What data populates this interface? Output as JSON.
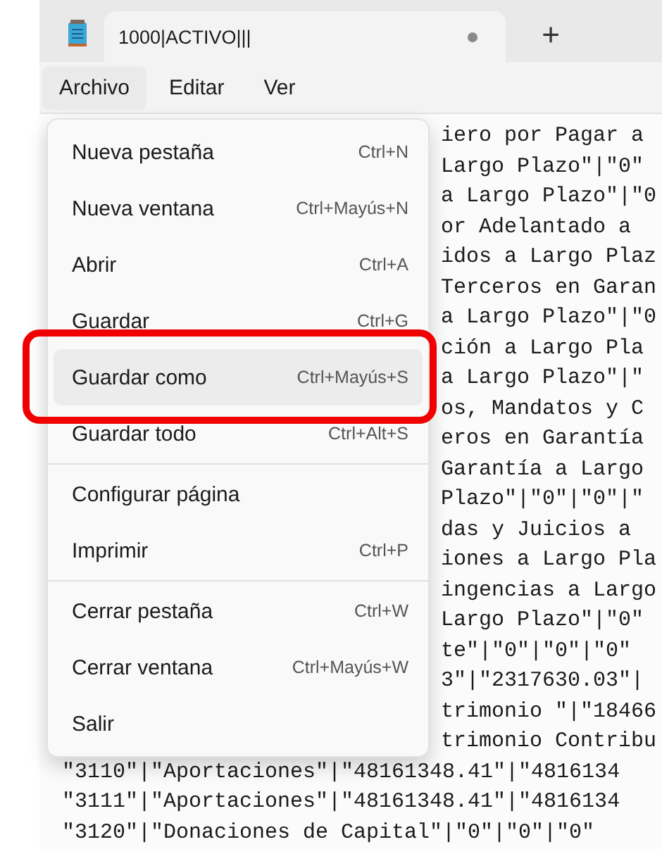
{
  "tabs": [
    {
      "title": "1000|ACTIVO|||",
      "selected": true,
      "unsaved": true
    }
  ],
  "new_tab_button": "+",
  "menu_bar": [
    {
      "label": "Archivo",
      "selected": true
    },
    {
      "label": "Editar",
      "selected": false
    },
    {
      "label": "Ver",
      "selected": false
    }
  ],
  "editor_lines": [
    {
      "kind": "partial",
      "text": "iero por Pagar a"
    },
    {
      "kind": "partial",
      "text": "Largo Plazo\"|\"0\""
    },
    {
      "kind": "partial",
      "text": "a Largo Plazo\"|\"0"
    },
    {
      "kind": "partial",
      "text": "or Adelantado a"
    },
    {
      "kind": "partial",
      "text": "idos a Largo Plaz"
    },
    {
      "kind": "partial",
      "text": "Terceros en Garan"
    },
    {
      "kind": "partial",
      "text": "a Largo Plazo\"|\"0"
    },
    {
      "kind": "partial",
      "text": "ción a Largo Pla"
    },
    {
      "kind": "partial",
      "text": "a Largo Plazo\"|\""
    },
    {
      "kind": "partial",
      "text": "os, Mandatos y C"
    },
    {
      "kind": "partial",
      "text": "eros en Garantía"
    },
    {
      "kind": "partial",
      "text": "Garantía a Largo"
    },
    {
      "kind": "partial",
      "text": "Plazo\"|\"0\"|\"0\"|\""
    },
    {
      "kind": "partial",
      "text": "das y Juicios a"
    },
    {
      "kind": "partial",
      "text": "iones a Largo Pla"
    },
    {
      "kind": "partial",
      "text": "ingencias a Largo"
    },
    {
      "kind": "partial",
      "text": "Largo Plazo\"|\"0\""
    },
    {
      "kind": "partial",
      "text": "te\"|\"0\"|\"0\"|\"0\""
    },
    {
      "kind": "partial",
      "text": "3\"|\"2317630.03\"|"
    },
    {
      "kind": "partial",
      "text": "trimonio \"|\"18466"
    },
    {
      "kind": "partial",
      "text": "trimonio Contribu"
    },
    {
      "kind": "full",
      "text": "\"3110\"|\"Aportaciones\"|\"48161348.41\"|\"4816134"
    },
    {
      "kind": "full",
      "text": "\"3111\"|\"Aportaciones\"|\"48161348.41\"|\"4816134"
    },
    {
      "kind": "full",
      "text": "\"3120\"|\"Donaciones de Capital\"|\"0\"|\"0\"|\"0\""
    }
  ],
  "file_menu": [
    {
      "kind": "item",
      "label": "Nueva pestaña",
      "shortcut": "Ctrl+N",
      "selected": false,
      "circled": false
    },
    {
      "kind": "item",
      "label": "Nueva ventana",
      "shortcut": "Ctrl+Mayús+N",
      "selected": false,
      "circled": false
    },
    {
      "kind": "item",
      "label": "Abrir",
      "shortcut": "Ctrl+A",
      "selected": false,
      "circled": false
    },
    {
      "kind": "item",
      "label": "Guardar",
      "shortcut": "Ctrl+G",
      "selected": false,
      "circled": false
    },
    {
      "kind": "item",
      "label": "Guardar como",
      "shortcut": "Ctrl+Mayús+S",
      "selected": true,
      "circled": true
    },
    {
      "kind": "item",
      "label": "Guardar todo",
      "shortcut": "Ctrl+Alt+S",
      "selected": false,
      "circled": false
    },
    {
      "kind": "separator"
    },
    {
      "kind": "item",
      "label": "Configurar página",
      "selected": false,
      "circled": false
    },
    {
      "kind": "item",
      "label": "Imprimir",
      "shortcut": "Ctrl+P",
      "selected": false,
      "circled": false
    },
    {
      "kind": "separator"
    },
    {
      "kind": "item",
      "label": "Cerrar pestaña",
      "shortcut": "Ctrl+W",
      "selected": false,
      "circled": false
    },
    {
      "kind": "item",
      "label": "Cerrar ventana",
      "shortcut": "Ctrl+Mayús+W",
      "selected": false,
      "circled": false
    },
    {
      "kind": "item",
      "label": "Salir",
      "selected": false,
      "circled": false
    }
  ]
}
